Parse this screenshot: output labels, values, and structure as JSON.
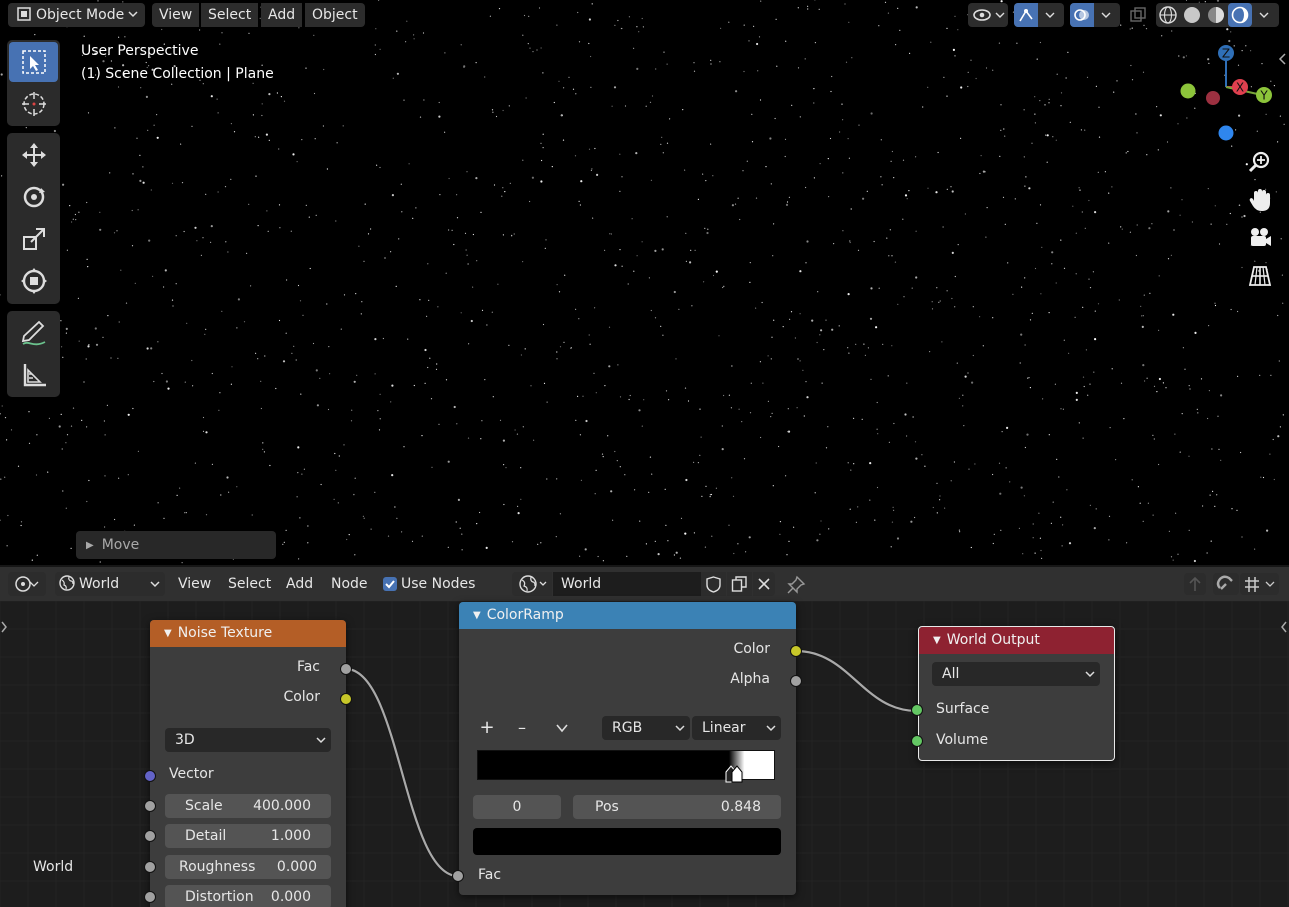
{
  "viewport_header": {
    "mode": "Object Mode",
    "menus": [
      "View",
      "Select",
      "Add",
      "Object"
    ]
  },
  "viewport_info": {
    "perspective": "User Perspective",
    "collection": "(1) Scene Collection | Plane"
  },
  "gizmo": {
    "z": "Z",
    "x": "X",
    "y": "Y"
  },
  "last_operator": "Move",
  "node_editor_header": {
    "editor_type_icon": "node-editor-icon",
    "shader_type": "World",
    "menus": [
      "View",
      "Select",
      "Add",
      "Node"
    ],
    "use_nodes_label": "Use Nodes",
    "use_nodes_checked": true,
    "datablock_name": "World"
  },
  "colors": {
    "noise_header": "#b45e26",
    "colorramp_header": "#3b82b5",
    "output_header": "#8e2231",
    "socket_grey": "#a1a1a1",
    "socket_yellow": "#c7c729",
    "socket_green": "#63c763",
    "socket_purple": "#6363c7",
    "active_tool": "#4772b3"
  },
  "nodes": {
    "noise": {
      "title": "Noise Texture",
      "outputs": [
        "Fac",
        "Color"
      ],
      "dimension": "3D",
      "vector_label": "Vector",
      "fields": [
        {
          "label": "Scale",
          "value": "400.000"
        },
        {
          "label": "Detail",
          "value": "1.000"
        },
        {
          "label": "Roughness",
          "value": "0.000"
        },
        {
          "label": "Distortion",
          "value": "0.000"
        }
      ]
    },
    "colorramp": {
      "title": "ColorRamp",
      "outputs": [
        "Color",
        "Alpha"
      ],
      "add": "+",
      "remove": "–",
      "color_mode": "RGB",
      "interpolation": "Linear",
      "index": "0",
      "pos_label": "Pos",
      "pos_value": "0.848",
      "input": "Fac"
    },
    "output": {
      "title": "World Output",
      "target": "All",
      "inputs": [
        "Surface",
        "Volume"
      ]
    }
  },
  "world_label": "World"
}
